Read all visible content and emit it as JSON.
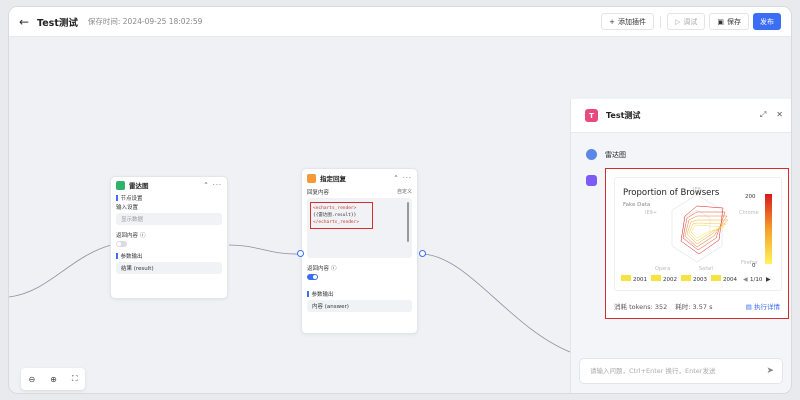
{
  "header": {
    "back_icon": "←",
    "title": "Test测试",
    "saved_time": "保存时间: 2024-09-25 18:02:59",
    "add_plugin": "添加插件",
    "debug": "调试",
    "save": "保存",
    "publish": "发布"
  },
  "node_radar": {
    "title": "雷达图",
    "more": "⌃ ···",
    "section_settings": "节点设置",
    "input_label": "输入设置",
    "input_value": "显示数据",
    "return_label": "返回内容",
    "return_help": "ⓘ",
    "output_section": "参数输出",
    "output_value": "结果 (result)"
  },
  "node_reply": {
    "title": "指定回复",
    "more": "⌃ ···",
    "reply_label": "回复内容",
    "mode": "自定义",
    "code_lines": [
      "<echarts_render>",
      "{{雷达图.result}}",
      "</echarts_render>"
    ],
    "return_label": "返回内容",
    "return_help": "ⓘ",
    "output_section": "参数输出",
    "output_value": "内容 (answer)"
  },
  "zoom": {
    "zoom_out": "⊖",
    "zoom_in": "⊕",
    "fit": "⛶"
  },
  "chat": {
    "avatar_letter": "T",
    "title": "Test测试",
    "expand_icon": "⤢",
    "close_icon": "✕",
    "user_message": "雷达图",
    "chart_title": "Proportion of Browsers",
    "chart_subtitle": "Fake Data",
    "radar_labels": [
      "IE8-",
      "Chrome",
      "Firefox",
      "Safari",
      "Opera",
      "IE9+"
    ],
    "visual_map": {
      "max": "200",
      "min": "0"
    },
    "legend": [
      "2001",
      "2002",
      "2003",
      "2004"
    ],
    "pager": "1/10",
    "tokens": "消耗 tokens: 352",
    "elapsed": "耗时: 3.57 s",
    "details": "执行详情",
    "input_placeholder": "请输入问题，Ctrl+Enter 换行，Enter发送",
    "send_icon": "➤"
  },
  "colors": {
    "primary": "#3b6ef5",
    "highlight": "#d32f2f",
    "legend_yellow": "#f5e342"
  }
}
